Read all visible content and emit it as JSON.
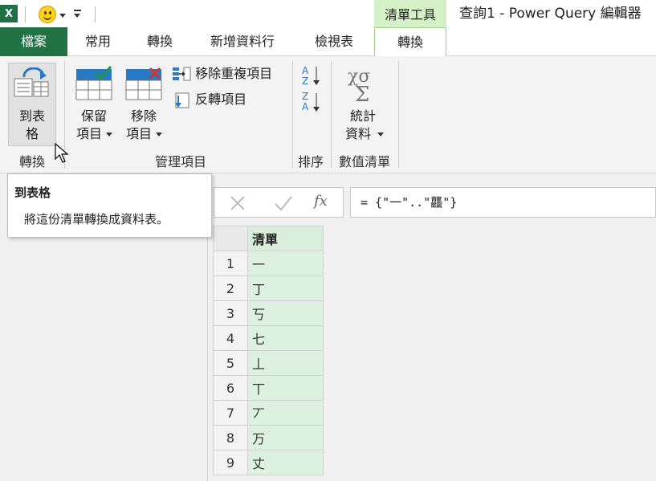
{
  "title_bar": {
    "excel_logo": "X",
    "context_tab_header": "清單工具",
    "window_title": "查詢1 - Power Query 編輯器"
  },
  "tabs": [
    "檔案",
    "常用",
    "轉換",
    "新增資料行",
    "檢視表",
    "轉換"
  ],
  "ribbon": {
    "to_table": {
      "line1": "到表",
      "line2": "格"
    },
    "keep_items": {
      "line1": "保留",
      "line2": "項目"
    },
    "remove_items": {
      "line1": "移除",
      "line2": "項目"
    },
    "remove_duplicates": "移除重複項目",
    "reverse_items": "反轉項目",
    "statistics": {
      "line1": "統計",
      "line2": "資料"
    },
    "groups": {
      "convert": "轉換",
      "manage_items": "管理項目",
      "sort": "排序",
      "numeric_list": "數值清單"
    }
  },
  "tooltip": {
    "title": "到表格",
    "description": "將這份清單轉換成資料表。"
  },
  "formula_bar": {
    "fx": "fx",
    "formula": "= {\"一\"..\"龘\"}"
  },
  "grid": {
    "column_header": "清單",
    "rows": [
      {
        "n": "1",
        "v": "一"
      },
      {
        "n": "2",
        "v": "丁"
      },
      {
        "n": "3",
        "v": "丂"
      },
      {
        "n": "4",
        "v": "七"
      },
      {
        "n": "5",
        "v": "丄"
      },
      {
        "n": "6",
        "v": "丅"
      },
      {
        "n": "7",
        "v": "丆"
      },
      {
        "n": "8",
        "v": "万"
      },
      {
        "n": "9",
        "v": "丈"
      }
    ]
  },
  "colors": {
    "excel_green": "#217346",
    "context_tab": "#d4f0c6",
    "list_column": "#dcf1e0"
  }
}
